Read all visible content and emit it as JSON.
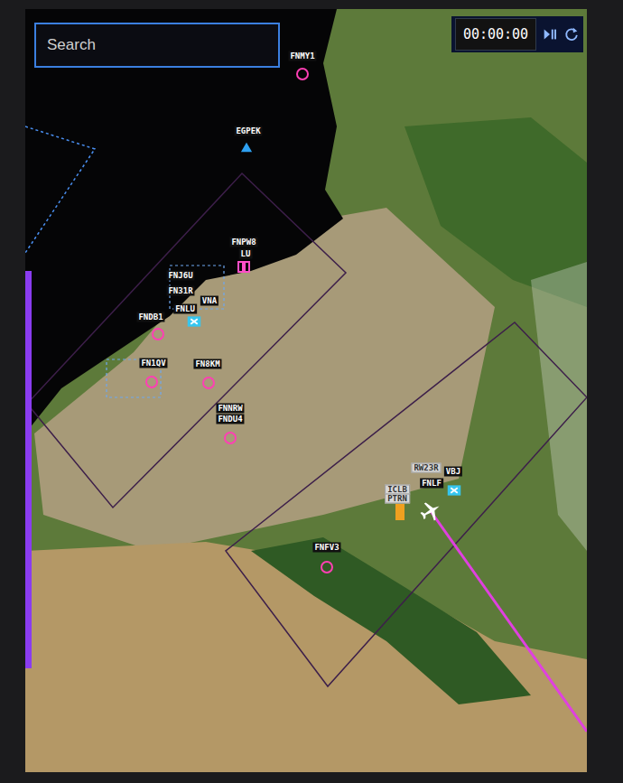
{
  "search": {
    "placeholder": "Search"
  },
  "timer": {
    "time": "00:00:00"
  },
  "map": {
    "labels": [
      {
        "text": "FNMY1",
        "boxed": false
      },
      {
        "text": "EGPEK",
        "boxed": false
      },
      {
        "text": "FNPW8",
        "boxed": false
      },
      {
        "text": "LU",
        "boxed": false
      },
      {
        "text": "FNJ6U",
        "boxed": false
      },
      {
        "text": "FN31R",
        "boxed": false
      },
      {
        "text": "VNA",
        "boxed": false
      },
      {
        "text": "FNLU",
        "boxed": false
      },
      {
        "text": "FNDB1",
        "boxed": false
      },
      {
        "text": "FN1QV",
        "boxed": false
      },
      {
        "text": "FN8KM",
        "boxed": false
      },
      {
        "text": "FNNRW",
        "boxed": false
      },
      {
        "text": "FNDU4",
        "boxed": false
      },
      {
        "text": "RW23R",
        "boxed": true
      },
      {
        "text": "VBJ",
        "boxed": false
      },
      {
        "text": "FNLF",
        "boxed": false
      },
      {
        "text": "ICLB",
        "boxed": true
      },
      {
        "text": "PTRN",
        "boxed": true
      },
      {
        "text": "FNFV3",
        "boxed": false
      }
    ],
    "symbols": [
      {
        "kind": "waypoint"
      },
      {
        "kind": "vor"
      },
      {
        "kind": "heliport"
      },
      {
        "kind": "airport"
      },
      {
        "kind": "waypoint"
      },
      {
        "kind": "waypoint"
      },
      {
        "kind": "waypoint"
      },
      {
        "kind": "waypoint"
      },
      {
        "kind": "airport"
      },
      {
        "kind": "parking"
      },
      {
        "kind": "aircraft"
      },
      {
        "kind": "waypoint"
      }
    ]
  }
}
